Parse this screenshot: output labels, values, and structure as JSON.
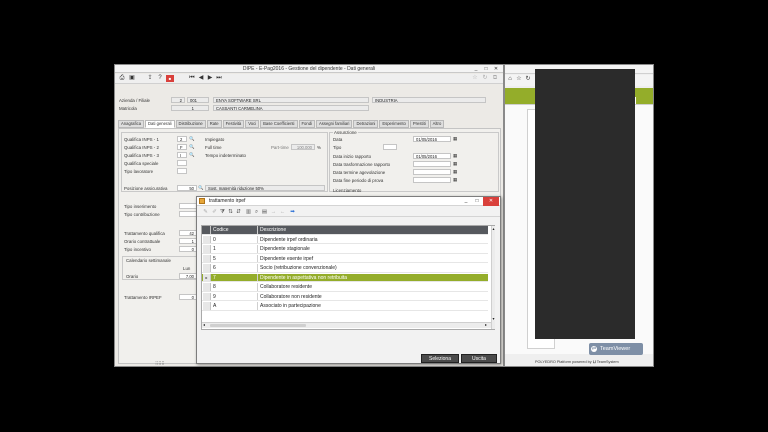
{
  "window": {
    "title": "DIPE  -  E-Pag2016  -  Gestione del dipendente - Dati generali",
    "controls": [
      "_",
      "□",
      "✕"
    ]
  },
  "header": {
    "azienda_label": "Azienda / Filiale",
    "azienda_code": "2",
    "filiale_code": "001",
    "azienda_name": "ENYA SOFTWARE SRL",
    "settore": "INDUSTRIA",
    "matricola_label": "Matricola",
    "matricola_code": "1",
    "dipendente_name": "CASSANTI CARMELINA"
  },
  "tabs": [
    "Anagrafica",
    "Dati generali",
    "Distribuzione",
    "Rate",
    "Festività",
    "Voci",
    "Base Coefficienti",
    "Fondi",
    "Assegni familiari",
    "Detrazioni",
    "Esperimento",
    "Prestiti",
    "Altro"
  ],
  "left_fields": {
    "qualifica1_label": "Qualifica INPS - 1",
    "qualifica1_value": "2",
    "qualifica1_desc": "Impiegato",
    "qualifica2_label": "Qualifica INPS - 2",
    "qualifica2_value": "F",
    "qualifica2_desc": "Full time",
    "parttime_label": "Part-time",
    "parttime_value": "100.000",
    "percent": "%",
    "qualifica3_label": "Qualifica INPS - 3",
    "qualifica3_value": "I",
    "qualifica3_desc": "Tempo indeterminato",
    "qualifica_speciale_label": "Qualifica speciale",
    "tipo_lavoratore_label": "Tipo lavoratore",
    "posizione_label": "Posizione assicurativa",
    "posizione_value": "50",
    "posizione_desc": "Sost. maternità riduzione 50%",
    "tipo_inserimento_label": "Tipo inserimento",
    "tipo_contribuzione_label": "Tipo contribuzione",
    "trattamento_qualifica_label": "Trattamento qualifica",
    "trattamento_qualifica_value": "42",
    "orario_contrattuale_label": "Orario contrattuale",
    "orario_contrattuale_value": "1",
    "tipo_incentivo_label": "Tipo incentivo",
    "tipo_incentivo_value": "0",
    "calendario_label": "Calendario settimanale",
    "lun_label": "Lun",
    "orario_label": "Orario",
    "orario_value": "7.00",
    "trattamento_irpef_label": "Trattamento IRPEF",
    "trattamento_irpef_value": "0"
  },
  "right_fields": {
    "assunzione_label": "Assunzione",
    "data_label": "Data",
    "data_value": "01/05/2016",
    "tipo_label": "Tipo",
    "data_inizio_label": "Data inizio rapporto",
    "data_inizio_value": "01/05/2016",
    "data_trasformazione_label": "Data trasformazione rapporto",
    "data_termine_label": "Data termine agevolazione",
    "data_fine_label": "Data fine periodo di prova",
    "licenziamento_label": "Licenziamento"
  },
  "dialog": {
    "title": "trattamento irpef",
    "columns": [
      "Codice",
      "Descrizione"
    ],
    "rows": [
      {
        "code": "0",
        "desc": "Dipendente irpef ordinaria"
      },
      {
        "code": "1",
        "desc": "Dipendente stagionale"
      },
      {
        "code": "5",
        "desc": "Dipendente esente irpef"
      },
      {
        "code": "6",
        "desc": "Socio (retribuzione convenzionale)"
      },
      {
        "code": "7",
        "desc": "Dipendente in aspettativa non retribuita"
      },
      {
        "code": "8",
        "desc": "Collaboratore residente"
      },
      {
        "code": "9",
        "desc": "Collaboratore non residente"
      },
      {
        "code": "A",
        "desc": "Associato in partecipazione"
      }
    ],
    "selected_index": 4,
    "row_marker": "▸",
    "seleziona_label": "Seleziona",
    "uscita_label": "Uscita"
  },
  "side": {
    "teamviewer_label": "TeamViewer",
    "polyedro_label": "POLYEDRO Platform powered by",
    "teamsystem_label": "TeamSystem"
  },
  "colors": {
    "selection": "#94ad2a",
    "header": "#56595e",
    "close": "#d9403b"
  },
  "icons": [
    "printer-icon",
    "save-icon",
    "upload-icon",
    "help-icon",
    "pdf-icon",
    "first-icon",
    "prev-icon",
    "next-icon",
    "last-icon",
    "star-icon",
    "refresh-icon",
    "copy-icon",
    "magnifier-icon",
    "calendar-icon"
  ]
}
